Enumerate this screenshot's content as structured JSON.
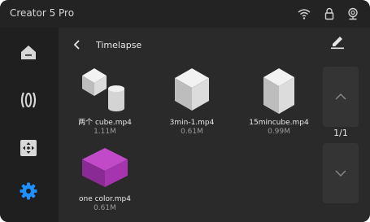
{
  "app": {
    "title": "Creator 5 Pro"
  },
  "status": {
    "icons": [
      "wifi-icon",
      "lock-icon",
      "camera-icon"
    ]
  },
  "sidebar": {
    "items": [
      {
        "icon": "home-icon",
        "active": false
      },
      {
        "icon": "filament-icon",
        "active": false
      },
      {
        "icon": "move-control-icon",
        "active": false
      },
      {
        "icon": "settings-gear-icon",
        "active": true
      }
    ]
  },
  "colors": {
    "accent": "#1e90ff",
    "cube_purple": "#9b30a5"
  },
  "page": {
    "title": "Timelapse"
  },
  "files": [
    {
      "name": "两个 cube.mp4",
      "size": "1.11M",
      "thumb": "cube-and-cylinder"
    },
    {
      "name": "3min-1.mp4",
      "size": "0.61M",
      "thumb": "cube"
    },
    {
      "name": "15mincube.mp4",
      "size": "0.99M",
      "thumb": "tall-cube"
    },
    {
      "name": "one color.mp4",
      "size": "0.61M",
      "thumb": "purple-slab"
    }
  ],
  "pagination": {
    "indicator": "1/1"
  }
}
